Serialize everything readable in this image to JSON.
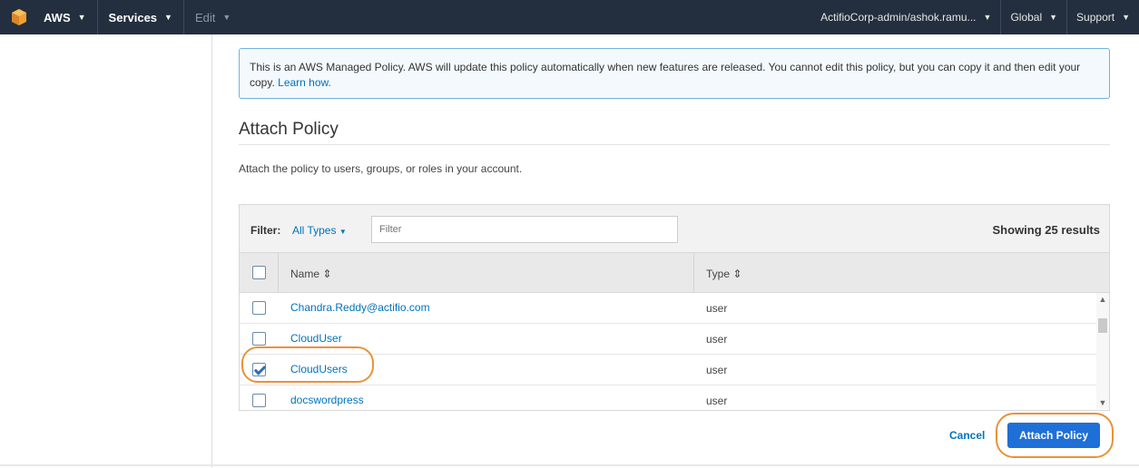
{
  "topnav": {
    "aws_label": "AWS",
    "services_label": "Services",
    "edit_label": "Edit",
    "account_label": "ActifioCorp-admin/ashok.ramu...",
    "region_label": "Global",
    "support_label": "Support",
    "logo_icon": "aws-cube-icon",
    "colors": {
      "bar": "#232f3e",
      "logo": "#f0a030"
    }
  },
  "info": {
    "text": "This is an AWS Managed Policy. AWS will update this policy automatically when new features are released. You cannot edit this policy, but you can copy it and then edit your copy.",
    "link": "Learn how."
  },
  "section": {
    "title": "Attach Policy",
    "description": "Attach the policy to users, groups, or roles in your account."
  },
  "filter": {
    "label": "Filter:",
    "type_selected": "All Types",
    "placeholder": "Filter",
    "results": "Showing 25 results"
  },
  "table": {
    "columns": [
      "Name",
      "Type"
    ],
    "sort_icon": "sort-icon",
    "rows": [
      {
        "name": "Chandra.Reddy@actifio.com",
        "type": "user",
        "checked": false
      },
      {
        "name": "CloudUser",
        "type": "user",
        "checked": false
      },
      {
        "name": "CloudUsers",
        "type": "user",
        "checked": true
      },
      {
        "name": "docswordpress",
        "type": "user",
        "checked": false
      }
    ]
  },
  "actions": {
    "cancel": "Cancel",
    "attach": "Attach Policy",
    "accent": "#1f6fd8",
    "highlight": "#e8923a"
  }
}
